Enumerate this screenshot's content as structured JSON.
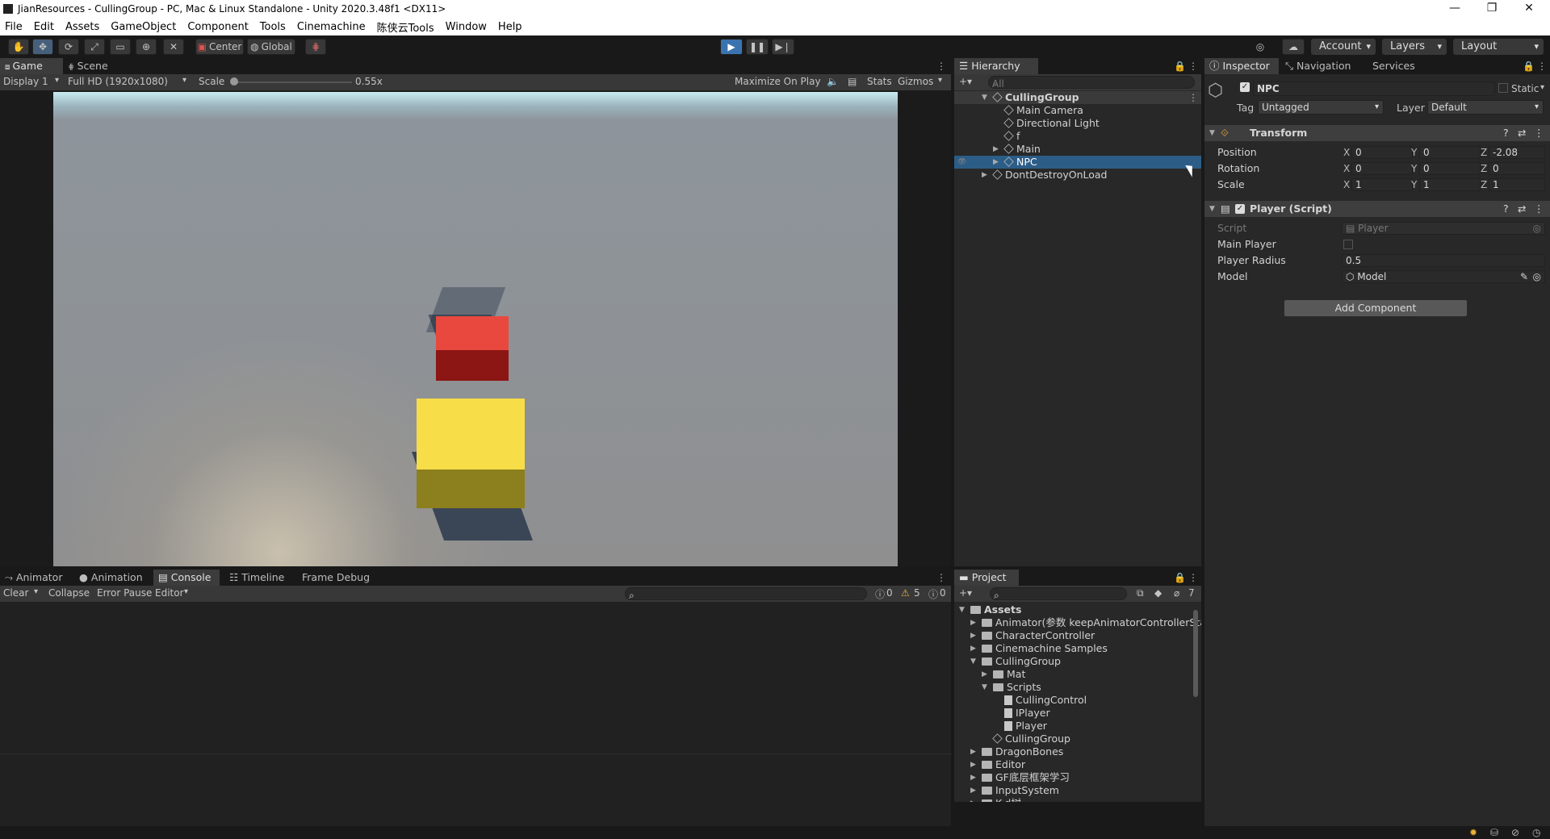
{
  "window": {
    "title": "JianResources - CullingGroup - PC, Mac & Linux Standalone - Unity 2020.3.48f1 <DX11>",
    "minimize": "—",
    "maximize": "❐",
    "close": "✕"
  },
  "menu": [
    "File",
    "Edit",
    "Assets",
    "GameObject",
    "Component",
    "Tools",
    "Cinemachine",
    "陈侠云Tools",
    "Window",
    "Help"
  ],
  "toolbar": {
    "pivot": "Center",
    "space": "Global",
    "account": "Account",
    "layers": "Layers",
    "layout": "Layout",
    "accent_color": "#4a8fd1"
  },
  "game_view": {
    "tabs": [
      "Game",
      "Scene"
    ],
    "display": "Display 1",
    "resolution": "Full HD (1920x1080)",
    "scale_label": "Scale",
    "scale_value": "0.55x",
    "maximize_on_play": "Maximize On Play",
    "stats": "Stats",
    "gizmos": "Gizmos",
    "cubes": [
      {
        "name": "red-cube",
        "color": "#e8453c"
      },
      {
        "name": "yellow-cube",
        "color": "#f7dd47"
      }
    ]
  },
  "hierarchy": {
    "tab": "Hierarchy",
    "search_placeholder": "All",
    "items": [
      {
        "label": "CullingGroup",
        "depth": 0
      },
      {
        "label": "Main Camera",
        "depth": 1
      },
      {
        "label": "Directional Light",
        "depth": 1
      },
      {
        "label": "f",
        "depth": 1
      },
      {
        "label": "Main",
        "depth": 1
      },
      {
        "label": "NPC",
        "depth": 1
      },
      {
        "label": "DontDestroyOnLoad",
        "depth": 0
      }
    ]
  },
  "inspector": {
    "tabs": [
      "Inspector",
      "Navigation",
      "Services"
    ],
    "object_name": "NPC",
    "static_label": "Static",
    "tag_label": "Tag",
    "tag_value": "Untagged",
    "layer_label": "Layer",
    "layer_value": "Default",
    "transform": {
      "title": "Transform",
      "rows": [
        {
          "label": "Position",
          "x": "0",
          "y": "0",
          "z": "-2.08"
        },
        {
          "label": "Rotation",
          "x": "0",
          "y": "0",
          "z": "0"
        },
        {
          "label": "Scale",
          "x": "1",
          "y": "1",
          "z": "1"
        }
      ]
    },
    "player_script": {
      "title": "Player (Script)",
      "script_label": "Script",
      "script_value": "Player",
      "main_player_label": "Main Player",
      "radius_label": "Player Radius",
      "radius_value": "0.5",
      "model_label": "Model",
      "model_value": "Model"
    },
    "add_component": "Add Component"
  },
  "console": {
    "tabs": [
      "Animator",
      "Animation",
      "Console",
      "Timeline",
      "Frame Debug"
    ],
    "clear": "Clear",
    "collapse": "Collapse",
    "error_pause": "Error Pause",
    "editor": "Editor",
    "log_count": "0",
    "warning_count": "5",
    "error_count": "0"
  },
  "project": {
    "tab": "Project",
    "hidden_count": "7",
    "items": [
      {
        "label": "Assets",
        "depth": 0,
        "type": "folder"
      },
      {
        "label": "Animator(参数 keepAnimatorControllerState",
        "depth": 1,
        "type": "folder"
      },
      {
        "label": "CharacterController",
        "depth": 1,
        "type": "folder"
      },
      {
        "label": "Cinemachine Samples",
        "depth": 1,
        "type": "folder"
      },
      {
        "label": "CullingGroup",
        "depth": 1,
        "type": "folder"
      },
      {
        "label": "Mat",
        "depth": 2,
        "type": "folder"
      },
      {
        "label": "Scripts",
        "depth": 2,
        "type": "folder"
      },
      {
        "label": "CullingControl",
        "depth": 3,
        "type": "script"
      },
      {
        "label": "IPlayer",
        "depth": 3,
        "type": "script"
      },
      {
        "label": "Player",
        "depth": 3,
        "type": "script"
      },
      {
        "label": "CullingGroup",
        "depth": 2,
        "type": "scene"
      },
      {
        "label": "DragonBones",
        "depth": 1,
        "type": "folder"
      },
      {
        "label": "Editor",
        "depth": 1,
        "type": "folder"
      },
      {
        "label": "GF底层框架学习",
        "depth": 1,
        "type": "folder"
      },
      {
        "label": "InputSystem",
        "depth": 1,
        "type": "folder"
      },
      {
        "label": "K-d树",
        "depth": 1,
        "type": "folder"
      }
    ]
  }
}
